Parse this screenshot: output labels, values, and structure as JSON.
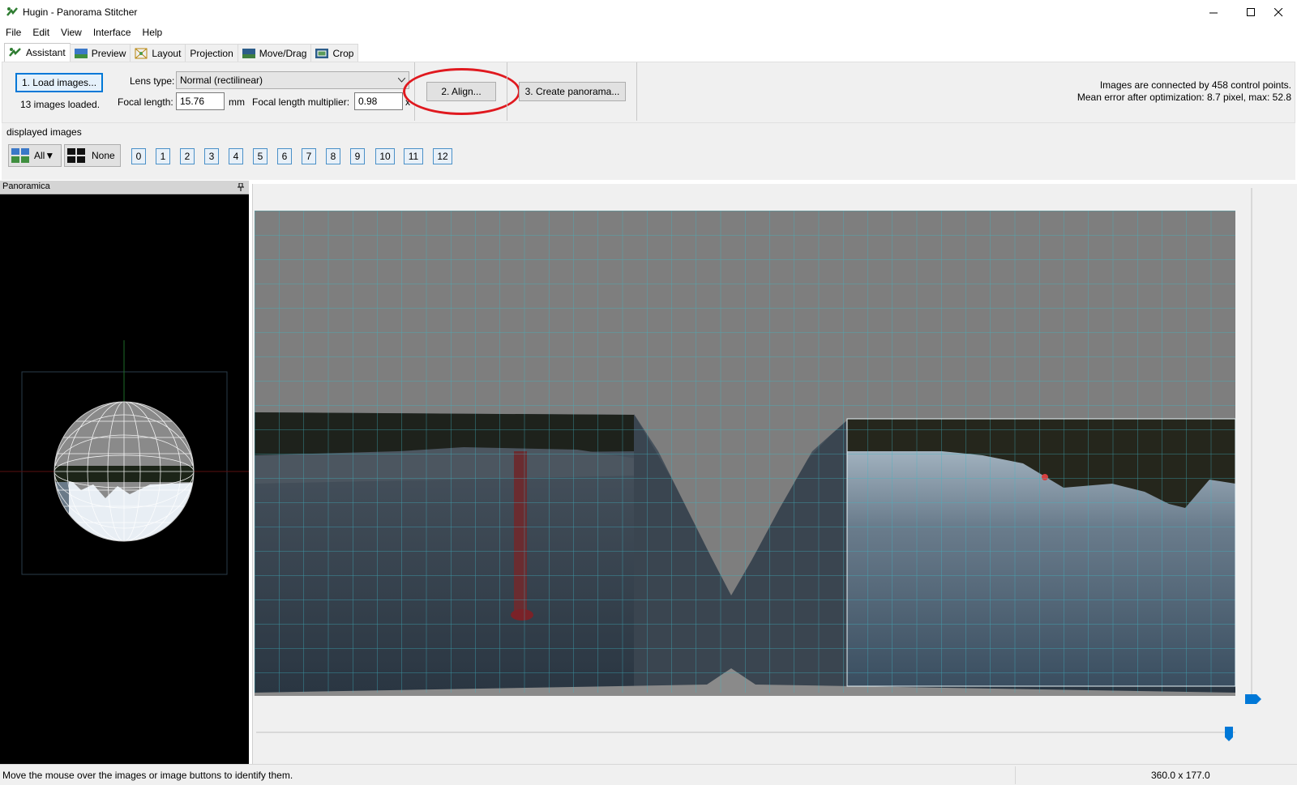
{
  "window": {
    "title": "Hugin - Panorama Stitcher",
    "controls": [
      "minimize",
      "maximize",
      "close"
    ]
  },
  "menu": [
    "File",
    "Edit",
    "View",
    "Interface",
    "Help"
  ],
  "tabs": [
    {
      "label": "Assistant",
      "icon": "assistant-icon",
      "active": true
    },
    {
      "label": "Preview",
      "icon": "preview-icon",
      "active": false
    },
    {
      "label": "Layout",
      "icon": "layout-icon",
      "active": false
    },
    {
      "label": "Projection",
      "icon": "",
      "active": false
    },
    {
      "label": "Move/Drag",
      "icon": "move-drag-icon",
      "active": false
    },
    {
      "label": "Crop",
      "icon": "crop-icon",
      "active": false
    }
  ],
  "assistant": {
    "load_button": "1. Load images...",
    "images_loaded": "13 images loaded.",
    "lens_type_label": "Lens type:",
    "lens_type_value": "Normal (rectilinear)",
    "focal_length_label": "Focal length:",
    "focal_length_value": "15.76",
    "focal_length_unit": "mm",
    "multiplier_label": "Focal length multiplier:",
    "multiplier_value": "0.98",
    "multiplier_unit": "x",
    "align_button": "2. Align...",
    "create_button": "3. Create panorama...",
    "status_line1": "Images are connected by 458 control points.",
    "status_line2": "Mean error after optimization: 8.7 pixel, max: 52.8"
  },
  "displayed_images": {
    "label": "displayed images",
    "all_button": "All▼",
    "none_button": "None",
    "image_buttons": [
      "0",
      "1",
      "2",
      "3",
      "4",
      "5",
      "6",
      "7",
      "8",
      "9",
      "10",
      "11",
      "12"
    ]
  },
  "panoramica": {
    "title": "Panoramica"
  },
  "statusbar": {
    "hint": "Move the mouse over the images or image buttons to identify them.",
    "fov": "360.0 x 177.0"
  },
  "colors": {
    "accent": "#0078d7",
    "highlight_ring": "#e0191f",
    "grid": "#3fb6c4"
  }
}
